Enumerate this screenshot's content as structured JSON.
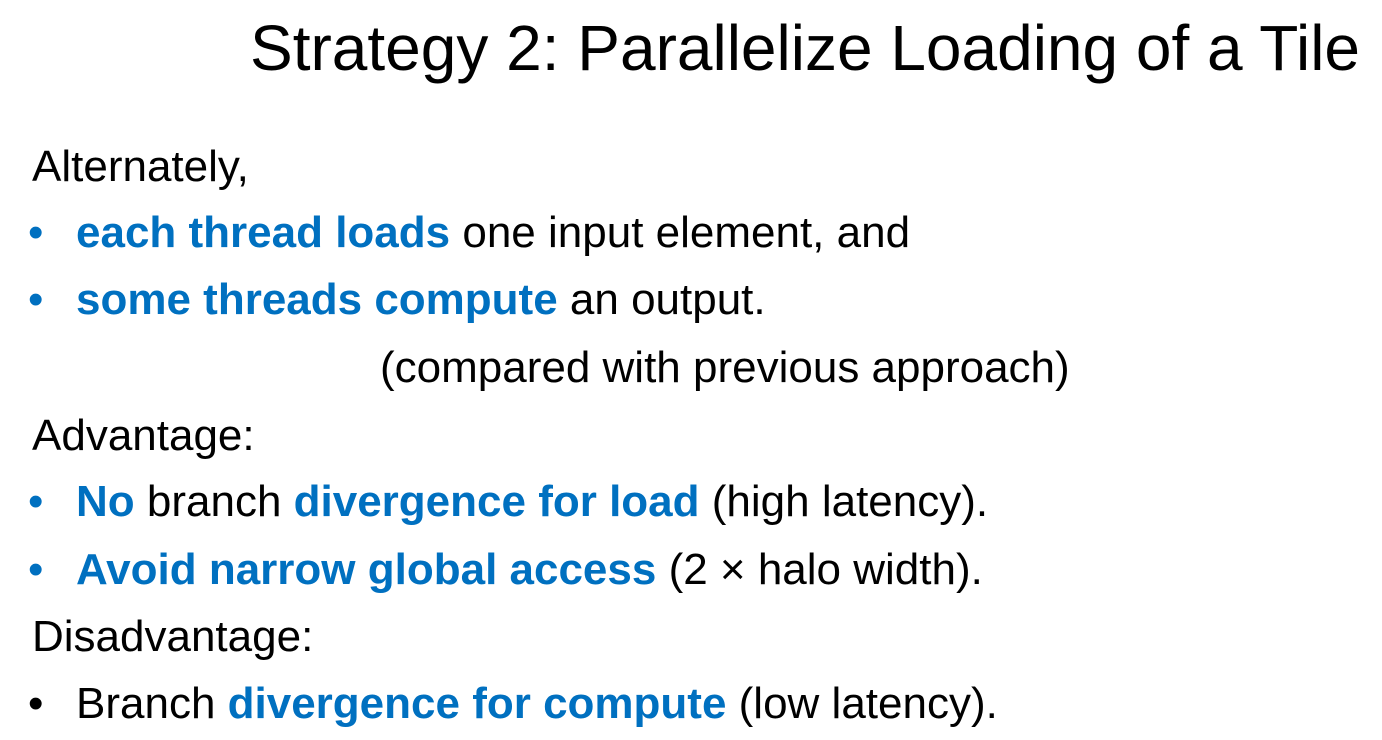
{
  "title": "Strategy 2: Parallelize Loading of a Tile",
  "intro": "Alternately,",
  "intro_bullets": [
    {
      "emph": "each thread loads",
      "rest": " one input element, and"
    },
    {
      "emph": "some threads compute",
      "rest": " an output."
    }
  ],
  "comparison_note": "(compared with previous approach)",
  "advantage_heading": "Advantage:",
  "advantage_bullets": [
    {
      "emph1": "No",
      "mid": " branch ",
      "emph2": "divergence for load",
      "rest": " (high latency)."
    },
    {
      "emph": "Avoid narrow global access",
      "rest": " (2 × halo width)."
    }
  ],
  "disadvantage_heading": "Disadvantage:",
  "disadvantage_bullets": [
    {
      "pre": "Branch ",
      "emph": "divergence for compute",
      "rest": " (low latency)."
    }
  ],
  "colors": {
    "accent": "#0070c0",
    "text": "#000000",
    "background": "#ffffff"
  },
  "bullet_glyph": "•"
}
